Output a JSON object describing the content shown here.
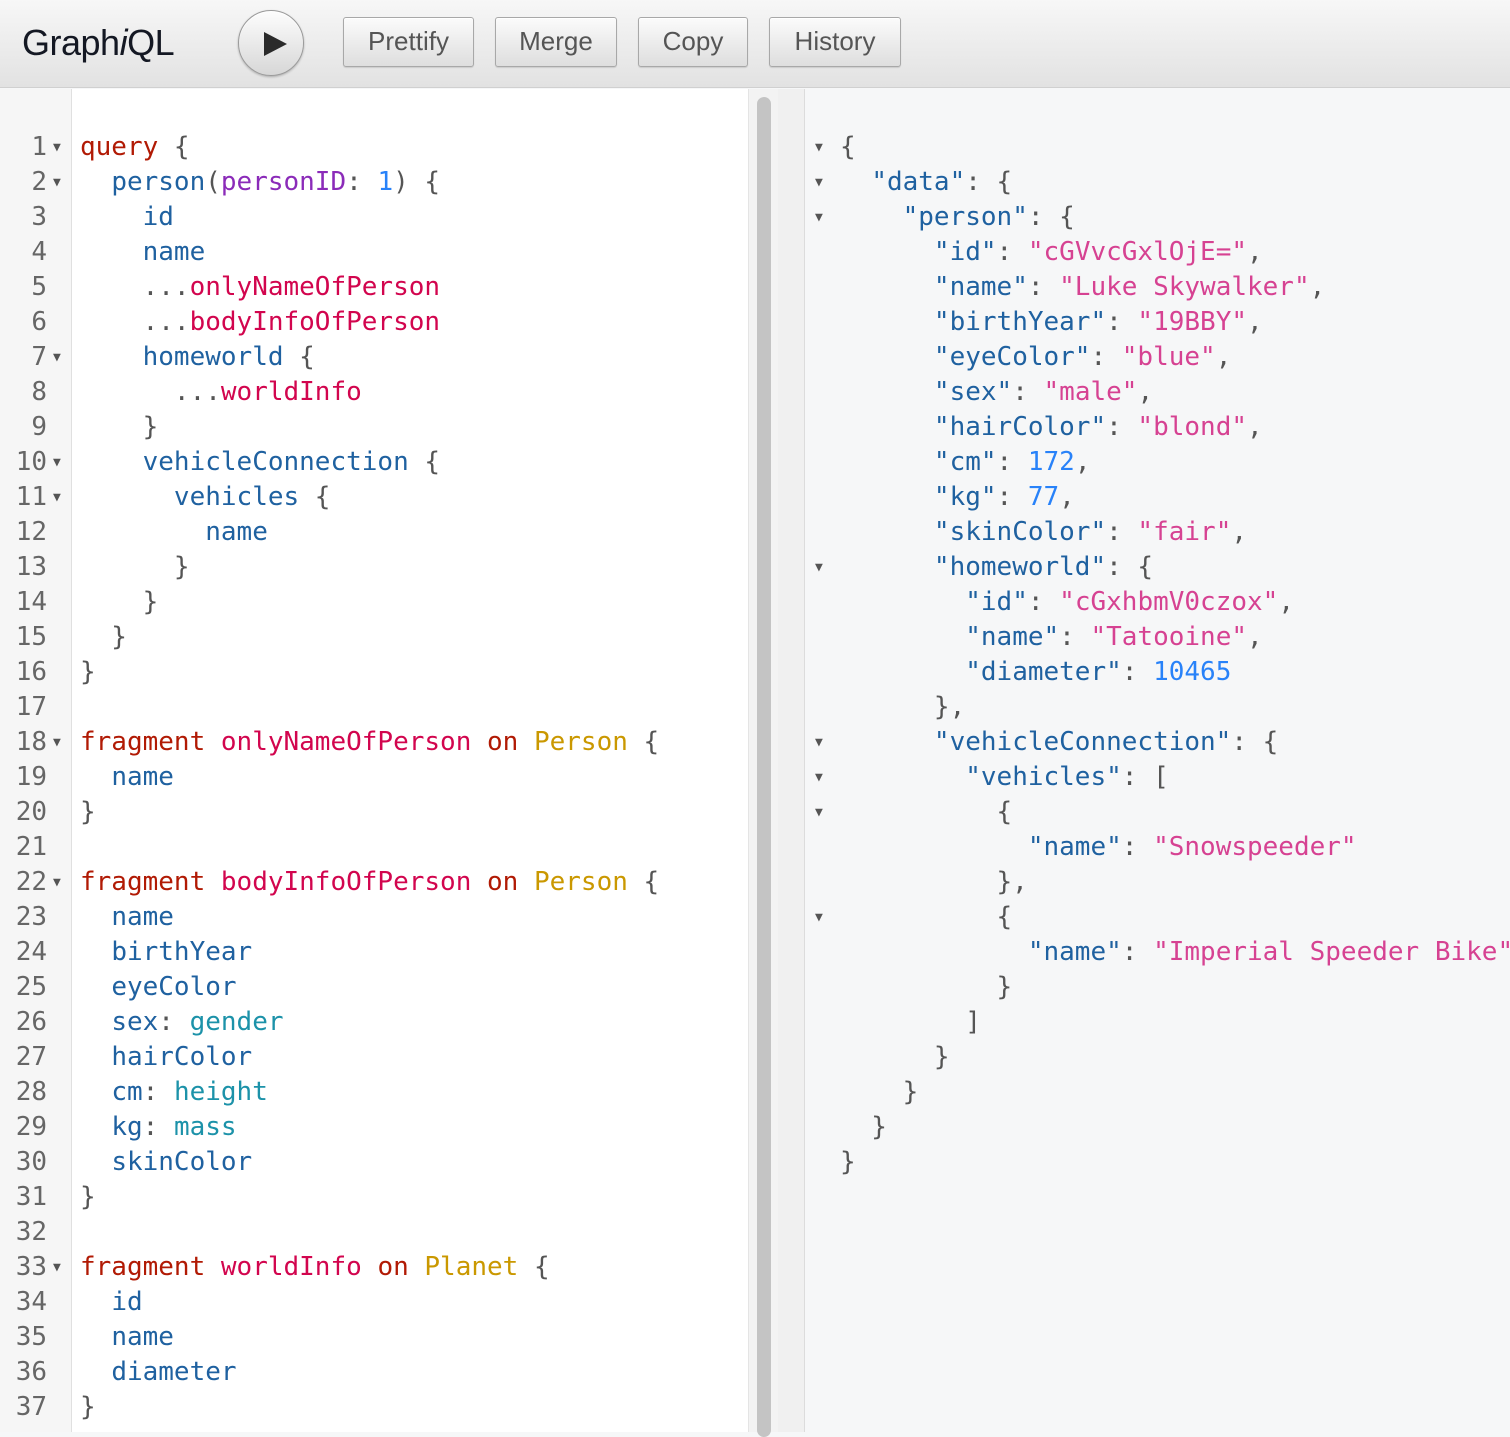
{
  "app": {
    "title_prefix": "Graph",
    "title_italic": "i",
    "title_suffix": "QL"
  },
  "toolbar": {
    "prettify_label": "Prettify",
    "merge_label": "Merge",
    "copy_label": "Copy",
    "history_label": "History"
  },
  "editor": {
    "lines": [
      {
        "n": "1",
        "fold": true,
        "tokens": [
          [
            "kw",
            "query"
          ],
          [
            "pun",
            " {"
          ]
        ]
      },
      {
        "n": "2",
        "fold": true,
        "tokens": [
          [
            "pun",
            "  "
          ],
          [
            "prop",
            "person"
          ],
          [
            "pun",
            "("
          ],
          [
            "argn",
            "personID"
          ],
          [
            "pun",
            ": "
          ],
          [
            "num",
            "1"
          ],
          [
            "pun",
            ") {"
          ]
        ]
      },
      {
        "n": "3",
        "fold": false,
        "tokens": [
          [
            "pun",
            "    "
          ],
          [
            "prop",
            "id"
          ]
        ]
      },
      {
        "n": "4",
        "fold": false,
        "tokens": [
          [
            "pun",
            "    "
          ],
          [
            "prop",
            "name"
          ]
        ]
      },
      {
        "n": "5",
        "fold": false,
        "tokens": [
          [
            "pun",
            "    ..."
          ],
          [
            "def",
            "onlyNameOfPerson"
          ]
        ]
      },
      {
        "n": "6",
        "fold": false,
        "tokens": [
          [
            "pun",
            "    ..."
          ],
          [
            "def",
            "bodyInfoOfPerson"
          ]
        ]
      },
      {
        "n": "7",
        "fold": true,
        "tokens": [
          [
            "pun",
            "    "
          ],
          [
            "prop",
            "homeworld"
          ],
          [
            "pun",
            " {"
          ]
        ]
      },
      {
        "n": "8",
        "fold": false,
        "tokens": [
          [
            "pun",
            "      ..."
          ],
          [
            "def",
            "worldInfo"
          ]
        ]
      },
      {
        "n": "9",
        "fold": false,
        "tokens": [
          [
            "pun",
            "    }"
          ]
        ]
      },
      {
        "n": "10",
        "fold": true,
        "tokens": [
          [
            "pun",
            "    "
          ],
          [
            "prop",
            "vehicleConnection"
          ],
          [
            "pun",
            " {"
          ]
        ]
      },
      {
        "n": "11",
        "fold": true,
        "tokens": [
          [
            "pun",
            "      "
          ],
          [
            "prop",
            "vehicles"
          ],
          [
            "pun",
            " {"
          ]
        ]
      },
      {
        "n": "12",
        "fold": false,
        "tokens": [
          [
            "pun",
            "        "
          ],
          [
            "prop",
            "name"
          ]
        ]
      },
      {
        "n": "13",
        "fold": false,
        "tokens": [
          [
            "pun",
            "      }"
          ]
        ]
      },
      {
        "n": "14",
        "fold": false,
        "tokens": [
          [
            "pun",
            "    }"
          ]
        ]
      },
      {
        "n": "15",
        "fold": false,
        "tokens": [
          [
            "pun",
            "  }"
          ]
        ]
      },
      {
        "n": "16",
        "fold": false,
        "tokens": [
          [
            "pun",
            "}"
          ]
        ]
      },
      {
        "n": "17",
        "fold": false,
        "tokens": []
      },
      {
        "n": "18",
        "fold": true,
        "tokens": [
          [
            "kw",
            "fragment"
          ],
          [
            "pun",
            " "
          ],
          [
            "def",
            "onlyNameOfPerson"
          ],
          [
            "pun",
            " "
          ],
          [
            "kw",
            "on"
          ],
          [
            "pun",
            " "
          ],
          [
            "typ",
            "Person"
          ],
          [
            "pun",
            " {"
          ]
        ]
      },
      {
        "n": "19",
        "fold": false,
        "tokens": [
          [
            "pun",
            "  "
          ],
          [
            "prop",
            "name"
          ]
        ]
      },
      {
        "n": "20",
        "fold": false,
        "tokens": [
          [
            "pun",
            "}"
          ]
        ]
      },
      {
        "n": "21",
        "fold": false,
        "tokens": []
      },
      {
        "n": "22",
        "fold": true,
        "tokens": [
          [
            "kw",
            "fragment"
          ],
          [
            "pun",
            " "
          ],
          [
            "def",
            "bodyInfoOfPerson"
          ],
          [
            "pun",
            " "
          ],
          [
            "kw",
            "on"
          ],
          [
            "pun",
            " "
          ],
          [
            "typ",
            "Person"
          ],
          [
            "pun",
            " {"
          ]
        ]
      },
      {
        "n": "23",
        "fold": false,
        "tokens": [
          [
            "pun",
            "  "
          ],
          [
            "prop",
            "name"
          ]
        ]
      },
      {
        "n": "24",
        "fold": false,
        "tokens": [
          [
            "pun",
            "  "
          ],
          [
            "prop",
            "birthYear"
          ]
        ]
      },
      {
        "n": "25",
        "fold": false,
        "tokens": [
          [
            "pun",
            "  "
          ],
          [
            "prop",
            "eyeColor"
          ]
        ]
      },
      {
        "n": "26",
        "fold": false,
        "tokens": [
          [
            "pun",
            "  "
          ],
          [
            "prop",
            "sex"
          ],
          [
            "pun",
            ": "
          ],
          [
            "al",
            "gender"
          ]
        ]
      },
      {
        "n": "27",
        "fold": false,
        "tokens": [
          [
            "pun",
            "  "
          ],
          [
            "prop",
            "hairColor"
          ]
        ]
      },
      {
        "n": "28",
        "fold": false,
        "tokens": [
          [
            "pun",
            "  "
          ],
          [
            "prop",
            "cm"
          ],
          [
            "pun",
            ": "
          ],
          [
            "al",
            "height"
          ]
        ]
      },
      {
        "n": "29",
        "fold": false,
        "tokens": [
          [
            "pun",
            "  "
          ],
          [
            "prop",
            "kg"
          ],
          [
            "pun",
            ": "
          ],
          [
            "al",
            "mass"
          ]
        ]
      },
      {
        "n": "30",
        "fold": false,
        "tokens": [
          [
            "pun",
            "  "
          ],
          [
            "prop",
            "skinColor"
          ]
        ]
      },
      {
        "n": "31",
        "fold": false,
        "tokens": [
          [
            "pun",
            "}"
          ]
        ]
      },
      {
        "n": "32",
        "fold": false,
        "tokens": []
      },
      {
        "n": "33",
        "fold": true,
        "tokens": [
          [
            "kw",
            "fragment"
          ],
          [
            "pun",
            " "
          ],
          [
            "def",
            "worldInfo"
          ],
          [
            "pun",
            " "
          ],
          [
            "kw",
            "on"
          ],
          [
            "pun",
            " "
          ],
          [
            "typ",
            "Planet"
          ],
          [
            "pun",
            " {"
          ]
        ]
      },
      {
        "n": "34",
        "fold": false,
        "tokens": [
          [
            "pun",
            "  "
          ],
          [
            "prop",
            "id"
          ]
        ]
      },
      {
        "n": "35",
        "fold": false,
        "tokens": [
          [
            "pun",
            "  "
          ],
          [
            "prop",
            "name"
          ]
        ]
      },
      {
        "n": "36",
        "fold": false,
        "tokens": [
          [
            "pun",
            "  "
          ],
          [
            "prop",
            "diameter"
          ]
        ]
      },
      {
        "n": "37",
        "fold": false,
        "tokens": [
          [
            "pun",
            "}"
          ]
        ]
      }
    ]
  },
  "result": {
    "lines": [
      {
        "fold": true,
        "tokens": [
          [
            "pun",
            "{"
          ]
        ]
      },
      {
        "fold": true,
        "tokens": [
          [
            "pun",
            "  "
          ],
          [
            "rkey",
            "\"data\""
          ],
          [
            "pun",
            ": {"
          ]
        ]
      },
      {
        "fold": true,
        "tokens": [
          [
            "pun",
            "    "
          ],
          [
            "rkey",
            "\"person\""
          ],
          [
            "pun",
            ": {"
          ]
        ]
      },
      {
        "fold": false,
        "tokens": [
          [
            "pun",
            "      "
          ],
          [
            "rkey",
            "\"id\""
          ],
          [
            "pun",
            ": "
          ],
          [
            "rstr",
            "\"cGVvcGxlOjE=\""
          ],
          [
            "pun",
            ","
          ]
        ]
      },
      {
        "fold": false,
        "tokens": [
          [
            "pun",
            "      "
          ],
          [
            "rkey",
            "\"name\""
          ],
          [
            "pun",
            ": "
          ],
          [
            "rstr",
            "\"Luke Skywalker\""
          ],
          [
            "pun",
            ","
          ]
        ]
      },
      {
        "fold": false,
        "tokens": [
          [
            "pun",
            "      "
          ],
          [
            "rkey",
            "\"birthYear\""
          ],
          [
            "pun",
            ": "
          ],
          [
            "rstr",
            "\"19BBY\""
          ],
          [
            "pun",
            ","
          ]
        ]
      },
      {
        "fold": false,
        "tokens": [
          [
            "pun",
            "      "
          ],
          [
            "rkey",
            "\"eyeColor\""
          ],
          [
            "pun",
            ": "
          ],
          [
            "rstr",
            "\"blue\""
          ],
          [
            "pun",
            ","
          ]
        ]
      },
      {
        "fold": false,
        "tokens": [
          [
            "pun",
            "      "
          ],
          [
            "rkey",
            "\"sex\""
          ],
          [
            "pun",
            ": "
          ],
          [
            "rstr",
            "\"male\""
          ],
          [
            "pun",
            ","
          ]
        ]
      },
      {
        "fold": false,
        "tokens": [
          [
            "pun",
            "      "
          ],
          [
            "rkey",
            "\"hairColor\""
          ],
          [
            "pun",
            ": "
          ],
          [
            "rstr",
            "\"blond\""
          ],
          [
            "pun",
            ","
          ]
        ]
      },
      {
        "fold": false,
        "tokens": [
          [
            "pun",
            "      "
          ],
          [
            "rkey",
            "\"cm\""
          ],
          [
            "pun",
            ": "
          ],
          [
            "rnum",
            "172"
          ],
          [
            "pun",
            ","
          ]
        ]
      },
      {
        "fold": false,
        "tokens": [
          [
            "pun",
            "      "
          ],
          [
            "rkey",
            "\"kg\""
          ],
          [
            "pun",
            ": "
          ],
          [
            "rnum",
            "77"
          ],
          [
            "pun",
            ","
          ]
        ]
      },
      {
        "fold": false,
        "tokens": [
          [
            "pun",
            "      "
          ],
          [
            "rkey",
            "\"skinColor\""
          ],
          [
            "pun",
            ": "
          ],
          [
            "rstr",
            "\"fair\""
          ],
          [
            "pun",
            ","
          ]
        ]
      },
      {
        "fold": true,
        "tokens": [
          [
            "pun",
            "      "
          ],
          [
            "rkey",
            "\"homeworld\""
          ],
          [
            "pun",
            ": {"
          ]
        ]
      },
      {
        "fold": false,
        "tokens": [
          [
            "pun",
            "        "
          ],
          [
            "rkey",
            "\"id\""
          ],
          [
            "pun",
            ": "
          ],
          [
            "rstr",
            "\"cGxhbmV0czox\""
          ],
          [
            "pun",
            ","
          ]
        ]
      },
      {
        "fold": false,
        "tokens": [
          [
            "pun",
            "        "
          ],
          [
            "rkey",
            "\"name\""
          ],
          [
            "pun",
            ": "
          ],
          [
            "rstr",
            "\"Tatooine\""
          ],
          [
            "pun",
            ","
          ]
        ]
      },
      {
        "fold": false,
        "tokens": [
          [
            "pun",
            "        "
          ],
          [
            "rkey",
            "\"diameter\""
          ],
          [
            "pun",
            ": "
          ],
          [
            "rnum",
            "10465"
          ]
        ]
      },
      {
        "fold": false,
        "tokens": [
          [
            "pun",
            "      },"
          ]
        ]
      },
      {
        "fold": true,
        "tokens": [
          [
            "pun",
            "      "
          ],
          [
            "rkey",
            "\"vehicleConnection\""
          ],
          [
            "pun",
            ": {"
          ]
        ]
      },
      {
        "fold": true,
        "tokens": [
          [
            "pun",
            "        "
          ],
          [
            "rkey",
            "\"vehicles\""
          ],
          [
            "pun",
            ": ["
          ]
        ]
      },
      {
        "fold": true,
        "tokens": [
          [
            "pun",
            "          {"
          ]
        ]
      },
      {
        "fold": false,
        "tokens": [
          [
            "pun",
            "            "
          ],
          [
            "rkey",
            "\"name\""
          ],
          [
            "pun",
            ": "
          ],
          [
            "rstr",
            "\"Snowspeeder\""
          ]
        ]
      },
      {
        "fold": false,
        "tokens": [
          [
            "pun",
            "          },"
          ]
        ]
      },
      {
        "fold": true,
        "tokens": [
          [
            "pun",
            "          {"
          ]
        ]
      },
      {
        "fold": false,
        "tokens": [
          [
            "pun",
            "            "
          ],
          [
            "rkey",
            "\"name\""
          ],
          [
            "pun",
            ": "
          ],
          [
            "rstr",
            "\"Imperial Speeder Bike\""
          ]
        ]
      },
      {
        "fold": false,
        "tokens": [
          [
            "pun",
            "          }"
          ]
        ]
      },
      {
        "fold": false,
        "tokens": [
          [
            "pun",
            "        ]"
          ]
        ]
      },
      {
        "fold": false,
        "tokens": [
          [
            "pun",
            "      }"
          ]
        ]
      },
      {
        "fold": false,
        "tokens": [
          [
            "pun",
            "    }"
          ]
        ]
      },
      {
        "fold": false,
        "tokens": [
          [
            "pun",
            "  }"
          ]
        ]
      },
      {
        "fold": false,
        "tokens": [
          [
            "pun",
            "}"
          ]
        ]
      }
    ]
  },
  "colors": {
    "keyword": "#b11a04",
    "definition": "#d2054e",
    "property": "#1f61a0",
    "argument": "#8b2bb9",
    "number": "#2882f9",
    "type": "#ca9800",
    "alias": "#1c92a9",
    "json_string": "#d64292"
  },
  "icons": {
    "run": "play-icon",
    "fold": "fold-arrow-icon"
  }
}
